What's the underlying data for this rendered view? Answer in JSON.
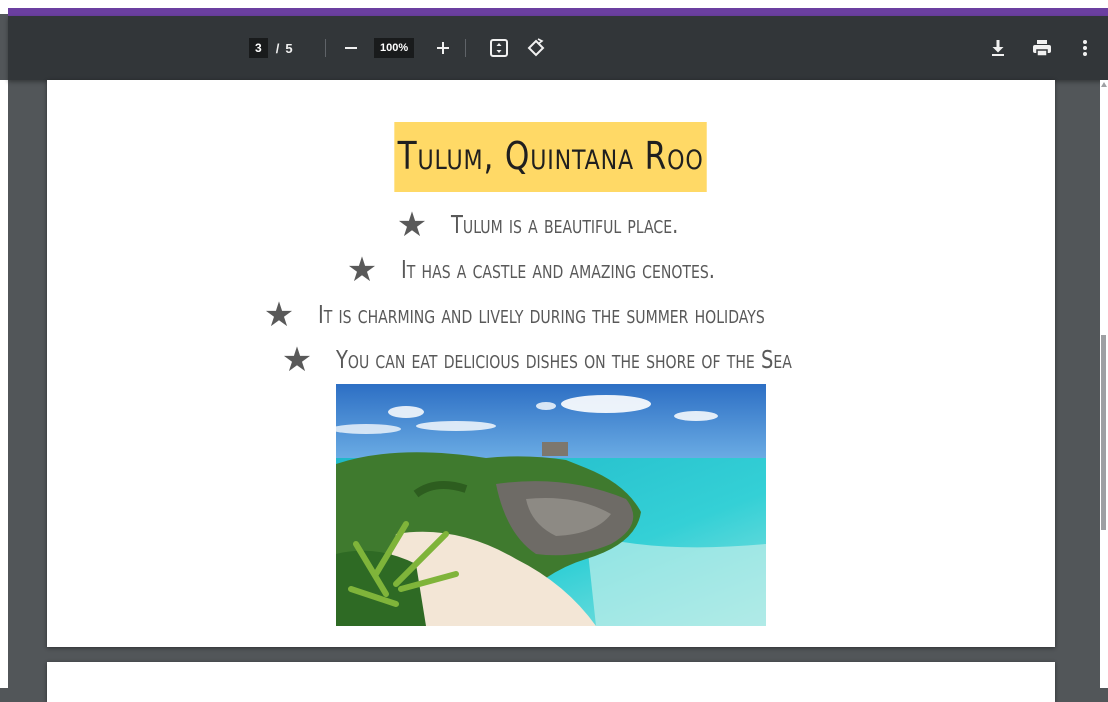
{
  "viewer": {
    "current_page": "3",
    "page_separator": "/",
    "total_pages": "5",
    "zoom": "100%",
    "zoom_out_symbol": "—",
    "zoom_in_symbol": "+",
    "icons": {
      "fit": "fit-to-page-icon",
      "rotate": "rotate-icon",
      "download": "download-icon",
      "print": "print-icon",
      "more": "more-vert-icon"
    }
  },
  "document": {
    "title": "Tulum, Quintana Roo",
    "bullet_symbol": "★",
    "bullets": [
      "Tulum is a beautiful place.",
      "It has a castle and amazing cenotes.",
      "It is charming and lively during the summer holidays",
      "You can eat delicious dishes on the shore of the Sea"
    ],
    "photo": "tulum-beach-photo"
  },
  "colors": {
    "toolbar": "#323639",
    "viewer_background": "#525659",
    "title_highlight": "#ffd966",
    "bullet_text": "#595959",
    "accent": "#6b3fa0"
  }
}
